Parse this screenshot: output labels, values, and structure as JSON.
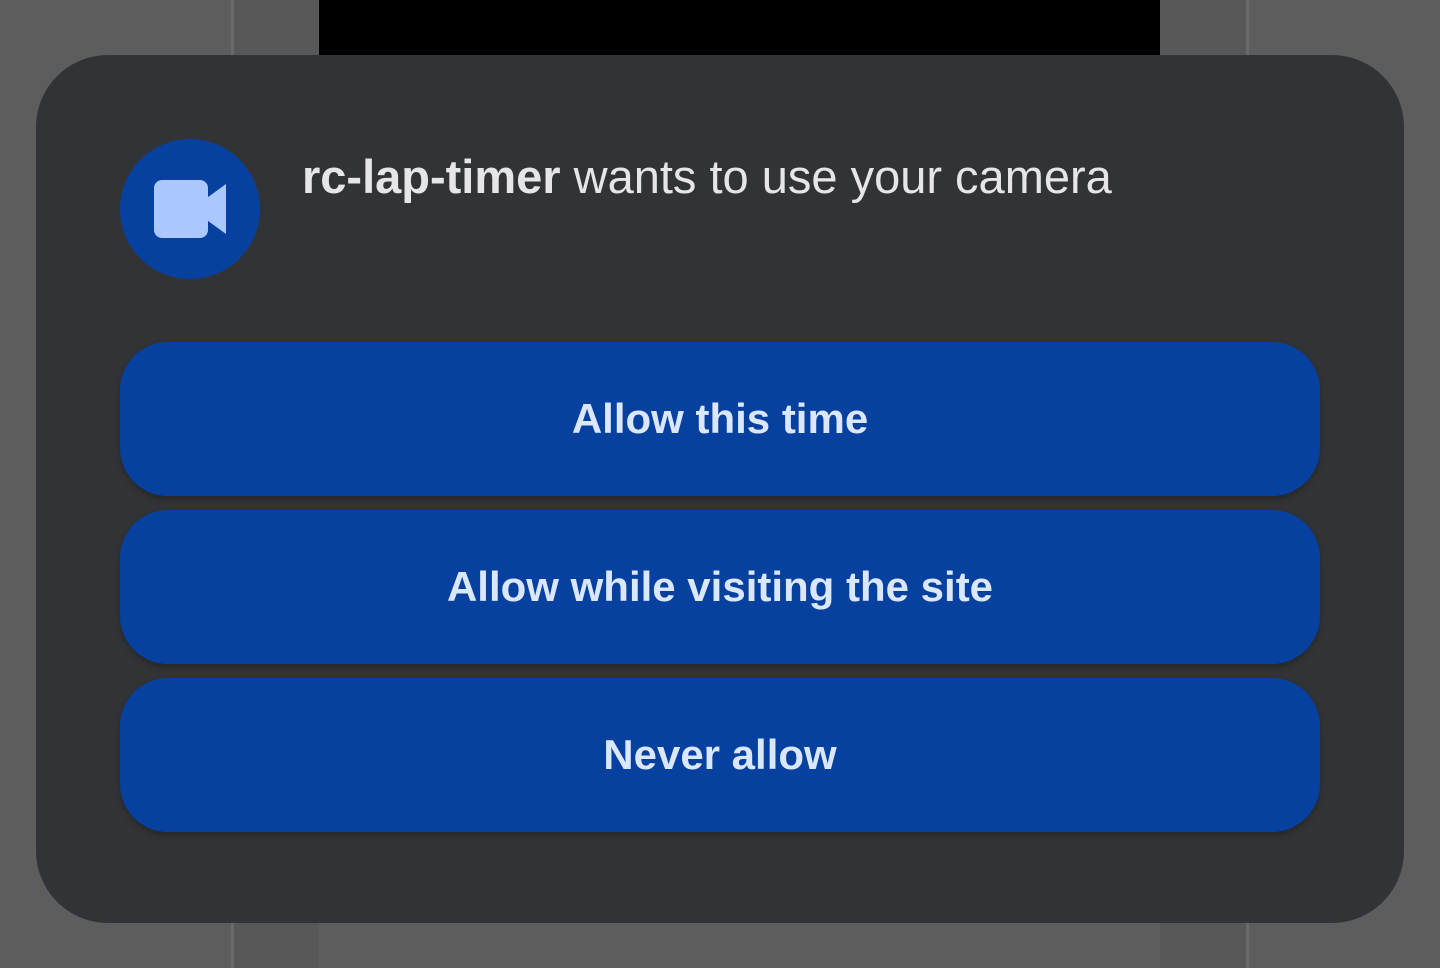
{
  "dialog": {
    "icon": "video-camera-icon",
    "title_app": "rc-lap-timer",
    "title_rest": " wants to use your camera"
  },
  "buttons": [
    {
      "label": "Allow this time"
    },
    {
      "label": "Allow while visiting the site"
    },
    {
      "label": "Never allow"
    }
  ],
  "colors": {
    "accent": "#0741a0",
    "dialog_bg": "#323336",
    "button_text": "#dbe6ff",
    "icon_fill": "#aac7ff"
  }
}
